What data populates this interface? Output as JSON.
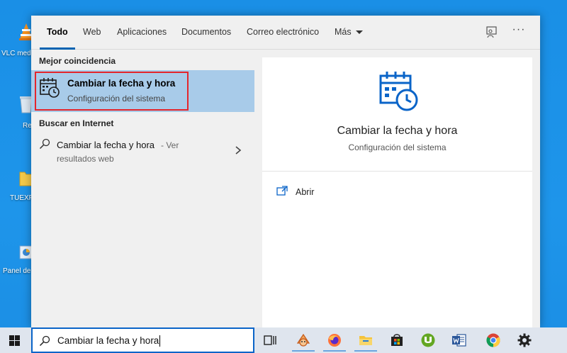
{
  "desktop": {
    "icons": [
      {
        "label": "VLC med",
        "icon": "vlc-icon"
      },
      {
        "label": "Re",
        "icon": "recycle-bin-icon"
      },
      {
        "label": "TUEXP",
        "icon": "folder-icon"
      },
      {
        "label": "Panel de",
        "icon": "control-panel-icon"
      }
    ]
  },
  "search_panel": {
    "tabs": [
      {
        "label": "Todo",
        "active": true
      },
      {
        "label": "Web"
      },
      {
        "label": "Aplicaciones"
      },
      {
        "label": "Documentos"
      },
      {
        "label": "Correo electrónico"
      },
      {
        "label": "Más",
        "icon": "chevron-down-icon"
      }
    ],
    "header_icons": {
      "feedback": "feedback-icon",
      "options": "more-options-icon",
      "options_glyph": "···"
    },
    "results": {
      "best_match_header": "Mejor coincidencia",
      "best_match": {
        "title": "Cambiar la fecha y hora",
        "subtitle": "Configuración del sistema",
        "icon": "calendar-clock-icon"
      },
      "web_header": "Buscar en Internet",
      "web_result": {
        "query": "Cambiar la fecha y hora",
        "suffix_line1": "- Ver",
        "suffix_line2": "resultados web",
        "icon": "search-icon",
        "arrow_icon": "chevron-right-icon"
      }
    },
    "preview": {
      "title": "Cambiar la fecha y hora",
      "subtitle": "Configuración del sistema",
      "icon": "calendar-clock-icon",
      "actions": [
        {
          "label": "Abrir",
          "icon": "open-icon"
        }
      ]
    }
  },
  "taskbar": {
    "start_icon": "windows-icon",
    "search": {
      "value": "Cambiar la fecha y hora",
      "icon": "search-icon"
    },
    "apps": [
      {
        "icon": "task-view-icon"
      },
      {
        "icon": "scratch-app-icon"
      },
      {
        "icon": "firefox-icon"
      },
      {
        "icon": "file-explorer-icon"
      },
      {
        "icon": "store-icon"
      },
      {
        "icon": "utorrent-icon"
      },
      {
        "icon": "word-icon"
      },
      {
        "icon": "chrome-icon"
      },
      {
        "icon": "settings-icon"
      }
    ]
  },
  "colors": {
    "accent": "#0063b1",
    "selection": "#a8cbe9",
    "highlight_outline": "#e4262c",
    "desktop": "#1e90e8",
    "icon_blue": "#0a64c8"
  }
}
